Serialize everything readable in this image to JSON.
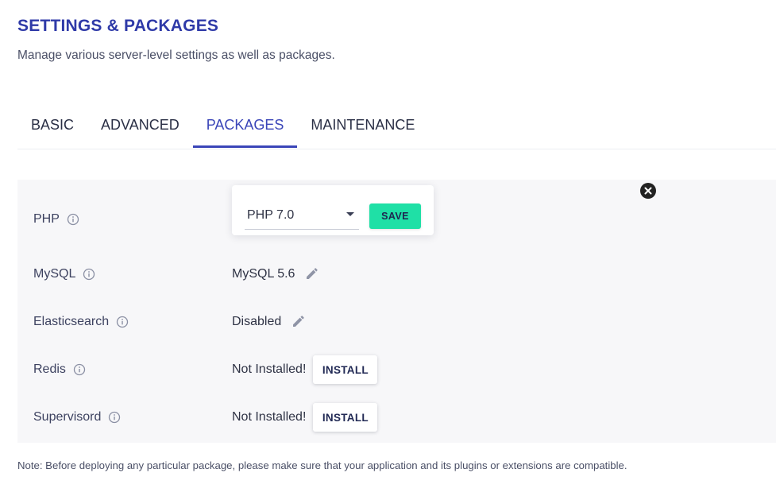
{
  "header": {
    "title": "SETTINGS & PACKAGES",
    "subtitle": "Manage various server-level settings as well as packages."
  },
  "tabs": [
    {
      "label": "BASIC",
      "active": false
    },
    {
      "label": "ADVANCED",
      "active": false
    },
    {
      "label": "PACKAGES",
      "active": true
    },
    {
      "label": "MAINTENANCE",
      "active": false
    }
  ],
  "packages": {
    "php": {
      "label": "PHP",
      "selected": "PHP 7.0",
      "save_label": "SAVE"
    },
    "mysql": {
      "label": "MySQL",
      "value": "MySQL 5.6"
    },
    "elasticsearch": {
      "label": "Elasticsearch",
      "value": "Disabled"
    },
    "redis": {
      "label": "Redis",
      "value": "Not Installed!",
      "button": "INSTALL"
    },
    "supervisord": {
      "label": "Supervisord",
      "value": "Not Installed!",
      "button": "INSTALL"
    }
  },
  "note": "Note: Before deploying any particular package, please make sure that your application and its plugins or extensions are compatible.",
  "colors": {
    "title": "#2f3aa8",
    "active_tab": "#3a45b8",
    "save_button": "#1fe0a6",
    "panel_bg": "#f7f7f9"
  },
  "icons": {
    "info": "info-circle-icon",
    "edit": "pencil-icon",
    "close": "close-icon",
    "dropdown": "caret-down-icon"
  }
}
